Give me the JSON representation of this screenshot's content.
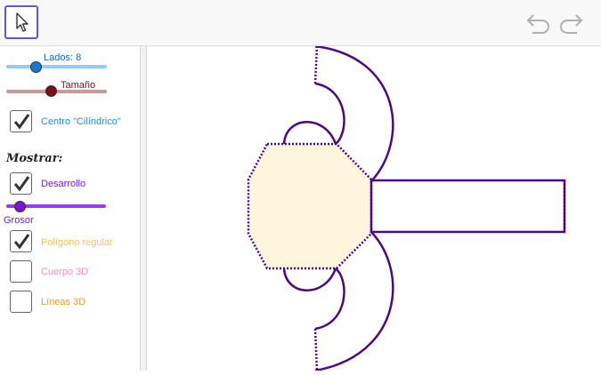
{
  "toolbar": {
    "tool_icon": "pointer-arrow-icon",
    "undo_icon": "undo-icon",
    "redo_icon": "redo-icon"
  },
  "sliders": {
    "lados": {
      "label": "Lados: 8",
      "color": "#1565c0",
      "track_color": "#90caf9",
      "value_fraction": 0.3
    },
    "tamano": {
      "label": "Tamaño",
      "color": "#7b0e14",
      "track_color": "#c8999b",
      "value_fraction": 0.45
    },
    "grosor": {
      "label": "Grosor",
      "color": "#7b16d9",
      "track_color": "#9b3bf0",
      "value_fraction": 0.12
    }
  },
  "checkboxes": {
    "centro": {
      "label": "Centro \"Cilíndrico\"",
      "checked": true,
      "color": "#1a8fd6"
    },
    "desarrollo": {
      "label": "Desarrollo",
      "checked": true,
      "color": "#7b16d9"
    },
    "poligono": {
      "label": "Polígono regular",
      "checked": true,
      "color": "#f2c44e"
    },
    "cuerpo": {
      "label": "Cuerpo 3D",
      "checked": false,
      "color": "#f08cc8"
    },
    "lineas": {
      "label": "Líneas 3D",
      "checked": false,
      "color": "#e8a020"
    }
  },
  "section_heading": "Mostrar:",
  "graphics": {
    "stroke_color": "#4b0a82",
    "polygon_fill": "#fdf5dc",
    "sides": 8
  }
}
